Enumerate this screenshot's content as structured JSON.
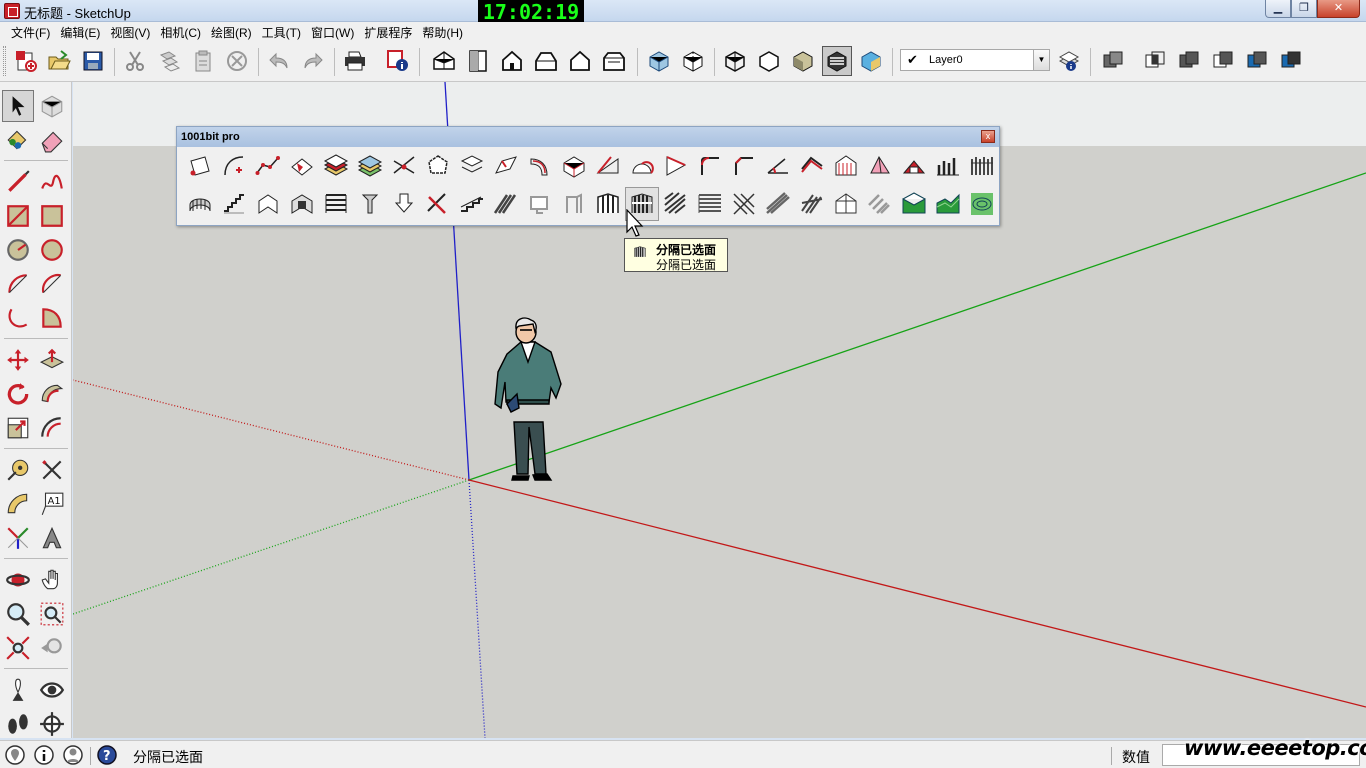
{
  "window": {
    "title": "无标题 - SketchUp",
    "clock": "17:02:19",
    "minimize": "▁",
    "maximize": "❐",
    "close": "✕"
  },
  "menu": [
    "文件(F)",
    "编辑(E)",
    "视图(V)",
    "相机(C)",
    "绘图(R)",
    "工具(T)",
    "窗口(W)",
    "扩展程序",
    "帮助(H)"
  ],
  "toolbar": {
    "layer_checked": "✔",
    "layer_name": "Layer0",
    "layer_dropdown": "▼",
    "icons": [
      "new-icon",
      "open-icon",
      "save-icon",
      "cut-icon",
      "copy-icon",
      "paste-icon",
      "erase-icon",
      "undo-icon",
      "redo-icon",
      "print-icon",
      "model-info-icon",
      "iso-view-icon",
      "top-view-icon",
      "front-view-icon",
      "right-view-icon",
      "back-view-icon",
      "left-view-icon",
      "xray-icon",
      "back-edges-icon",
      "wireframe-icon",
      "hidden-line-icon",
      "shaded-icon",
      "shaded-textures-icon",
      "monochrome-icon",
      "layer-manager-icon",
      "outer-shell-icon",
      "intersect-icon",
      "union-icon",
      "subtract-icon",
      "trim-icon",
      "split-icon"
    ]
  },
  "palette": {
    "title": "1001bit pro",
    "close_label": "x",
    "row1_count": 24,
    "row2_count": 24
  },
  "tooltip": {
    "title": "分隔已选面",
    "description": "分隔已选面"
  },
  "statusbar": {
    "message": "分隔已选面",
    "vcb_label": "数值",
    "vcb_value": ""
  },
  "watermark": "www.eeeetop.com",
  "colors": {
    "sky": "#eceeee",
    "ground": "#d0d0cc",
    "axis_red": "#c21818",
    "axis_green": "#16a316",
    "axis_blue": "#2020c8",
    "clock_text": "#19ff19"
  }
}
